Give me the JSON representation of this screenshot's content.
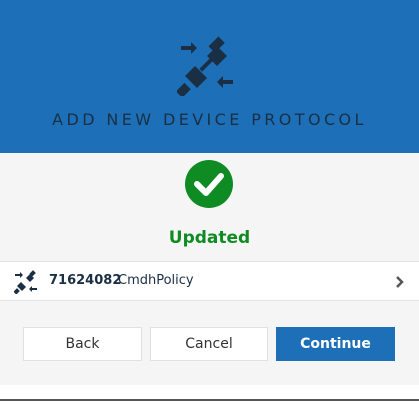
{
  "dialog": {
    "title": "ADD NEW DEVICE PROTOCOL",
    "header_icon": "plug-connect-icon",
    "status_icon": "check-circle-icon",
    "status_text": "Updated",
    "colors": {
      "header_bg": "#1d70b8",
      "status_green": "#0f8b23",
      "primary_button": "#1d70b8",
      "title_text": "#1a2f44"
    }
  },
  "protocol_item": {
    "icon": "plug-connect-icon",
    "id": "71624082",
    "name": "CmdhPolicy",
    "chevron_icon": "chevron-right-icon"
  },
  "buttons": {
    "back": "Back",
    "cancel": "Cancel",
    "continue": "Continue"
  }
}
